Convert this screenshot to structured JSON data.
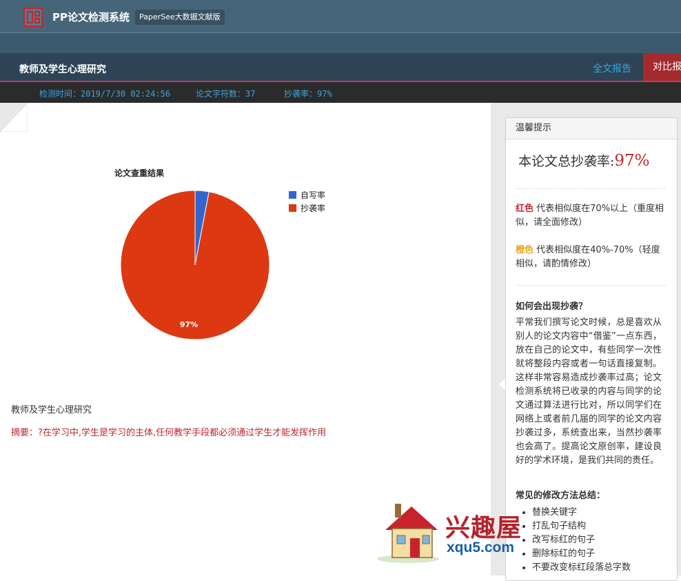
{
  "header": {
    "app_title": "PP论文检测系统",
    "edition_badge": "PaperSee大数据文献版"
  },
  "titlebar": {
    "doc_title": "教师及学生心理研究",
    "tab_full_report": "全文报告",
    "tab_compare_report": "对比报"
  },
  "infobar": {
    "check_time": "检测时间：2019/7/30 02:24:56",
    "char_count": "论文字符数：37",
    "plagiarism_rate": "抄袭率：97%"
  },
  "chart_data": {
    "type": "pie",
    "title": "论文查重结果",
    "slices": [
      {
        "name": "自写率",
        "value": 3,
        "color": "#3366cc"
      },
      {
        "name": "抄袭率",
        "value": 97,
        "color": "#dc3912"
      }
    ],
    "data_labels": [
      {
        "slice": "抄袭率",
        "text": "97%"
      }
    ],
    "legend_position": "right"
  },
  "document": {
    "heading": "教师及学生心理研究",
    "abstract": "摘要：?在学习中,学生是学习的主体,任何教学手段都必须通过学生才能发挥作用"
  },
  "tips": {
    "header": "温馨提示",
    "total_rate_label": "本论文总抄袭率:",
    "total_rate_value": "97%",
    "red_word": "红色",
    "red_desc": " 代表相似度在70%以上（重度相似，请全面修改）",
    "orange_word": "橙色",
    "orange_desc": " 代表相似度在40%-70%（轻度相似，请酌情修改）",
    "question_title": "如何会出现抄袭？",
    "question_body": "平常我们撰写论文时候，总是喜欢从别人的论文内容中“借鉴”一点东西，放在自己的论文中，有些同学一次性就将整段内容或者一句话直接复制。这样非常容易造成抄袭率过高；论文检测系统将已收录的内容与同学的论文通过算法进行比对，所以同学们在网络上或者前几届的同学的论文内容抄袭过多，系统查出来，当然抄袭率也会高了。提高论文原创率，建设良好的学术环境，是我们共同的责任。",
    "methods_title": "常见的修改方法总结：",
    "methods": [
      "替换关键字",
      "打乱句子结构",
      "改写标红的句子",
      "删除标红的句子",
      "不要改变标红段落总字数"
    ]
  },
  "watermark": {
    "text": "兴趣屋",
    "url": "xqu5.com"
  },
  "colors": {
    "topbar": "#466579",
    "titlebar": "#2c4456",
    "accent_red": "#c0262c",
    "link_blue": "#3aa6e0",
    "warning_orange": "#e8a317"
  }
}
